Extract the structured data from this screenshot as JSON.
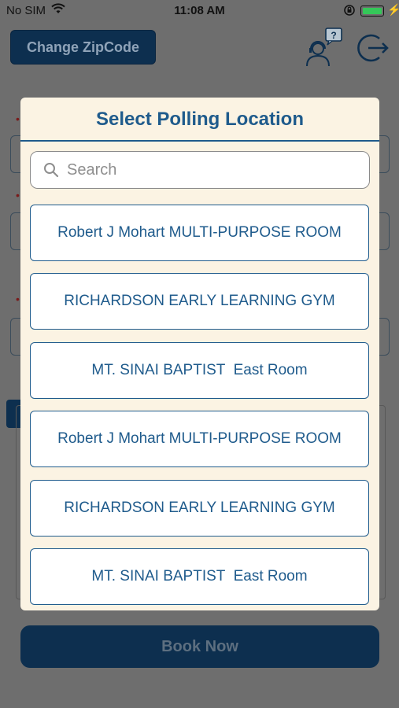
{
  "status_bar": {
    "carrier": "No SIM",
    "time": "11:08 AM"
  },
  "background": {
    "change_zip_label": "Change ZipCode",
    "book_now_label": "Book Now"
  },
  "modal": {
    "title": "Select Polling Location",
    "search_placeholder": "Search",
    "locations": [
      "Robert J Mohart MULTI-PURPOSE ROOM",
      "RICHARDSON EARLY LEARNING GYM",
      "MT. SINAI BAPTIST  East Room",
      "Robert J Mohart MULTI-PURPOSE ROOM",
      "RICHARDSON EARLY LEARNING GYM",
      "MT. SINAI BAPTIST  East Room"
    ]
  },
  "colors": {
    "accent": "#1f5b8c",
    "primary_button": "#0d2f4f",
    "modal_background": "#fbf3e3",
    "overlay": "#6e6e6e"
  },
  "icons": [
    "wifi-icon",
    "lock-rotation-icon",
    "battery-icon",
    "charging-bolt-icon",
    "support-agent-icon",
    "logout-icon",
    "search-icon"
  ]
}
